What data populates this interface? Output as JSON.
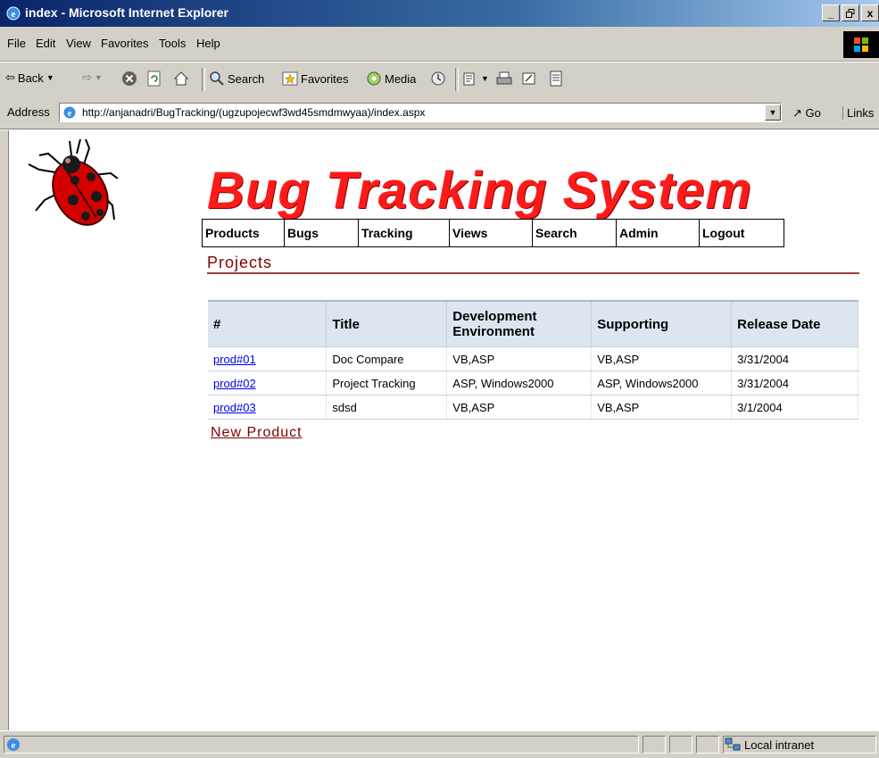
{
  "window": {
    "title": "index - Microsoft Internet Explorer",
    "controls": [
      "_",
      "ř",
      "x"
    ]
  },
  "menu": {
    "items": [
      "File",
      "Edit",
      "View",
      "Favorites",
      "Tools",
      "Help"
    ]
  },
  "toolbar": {
    "back_label": "Back",
    "search_label": "Search",
    "favorites_label": "Favorites",
    "media_label": "Media"
  },
  "address": {
    "label": "Address",
    "url": "http://anjanadri/BugTracking/(ugzupojecwf3wd45smdmwyaa)/index.aspx",
    "go_label": "Go",
    "links_label": "Links"
  },
  "page": {
    "logo_text": "Bug Tracking System",
    "nav": [
      "Products",
      "Bugs",
      "Tracking",
      "Views",
      "Search",
      "Admin",
      "Logout"
    ],
    "section_title": "Projects",
    "table": {
      "headers": [
        "#",
        "Title",
        "Development Environment",
        "Supporting",
        "Release Date"
      ],
      "rows": [
        [
          "prod#01",
          "Doc Compare",
          "VB,ASP",
          "VB,ASP",
          "3/31/2004"
        ],
        [
          "prod#02",
          "Project Tracking",
          "ASP, Windows2000",
          "ASP, Windows2000",
          "3/31/2004"
        ],
        [
          "prod#03",
          "sdsd",
          "VB,ASP",
          "VB,ASP",
          "3/1/2004"
        ]
      ]
    },
    "new_product_label": "New Product"
  },
  "status": {
    "zone_label": "Local intranet"
  },
  "colors": {
    "title_bar": "#0a246a",
    "chrome": "#d4d0c8",
    "logo_red": "#ff1a1a",
    "section_maroon": "#800000",
    "link_blue": "#0000ee",
    "header_bg": "#dde6f0"
  }
}
